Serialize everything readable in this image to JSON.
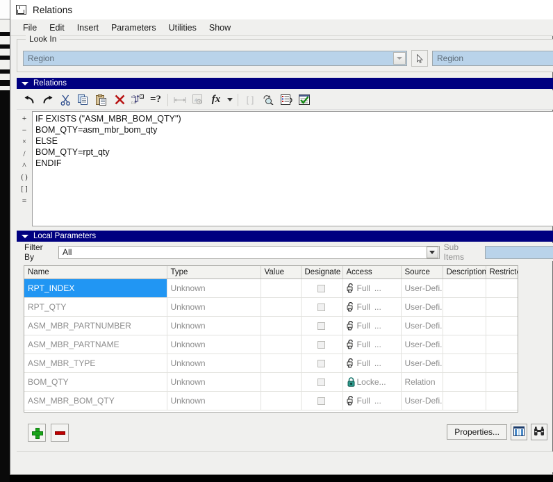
{
  "window": {
    "title": "Relations",
    "icon": "relations-window-icon"
  },
  "menubar": {
    "items": [
      {
        "label": "File"
      },
      {
        "label": "Edit"
      },
      {
        "label": "Insert"
      },
      {
        "label": "Parameters"
      },
      {
        "label": "Utilities"
      },
      {
        "label": "Show"
      }
    ]
  },
  "look_in": {
    "legend": "Look In",
    "combo_value": "Region",
    "pick_icon": "cursor-arrow-icon",
    "region_value": "Region"
  },
  "relations_section": {
    "title": "Relations",
    "collapse_icon": "triangle-down-icon",
    "toolbar": [
      {
        "name": "undo-button",
        "glyph": "↶",
        "disabled": false
      },
      {
        "name": "redo-button",
        "glyph": "↷",
        "disabled": false
      },
      {
        "name": "cut-button",
        "glyph": "✂",
        "disabled": false
      },
      {
        "name": "copy-button",
        "glyph": "❐",
        "disabled": false
      },
      {
        "name": "paste-button",
        "glyph": "ὌB",
        "disabled": false
      },
      {
        "name": "delete-button",
        "glyph": "✕",
        "disabled": false
      },
      {
        "name": "sort-button",
        "glyph": "⇅",
        "disabled": false
      },
      {
        "name": "evaluate-button",
        "glyph": "=?",
        "disabled": false
      },
      {
        "name": "dimension-button",
        "glyph": "↔",
        "disabled": true
      },
      {
        "name": "search-image-button",
        "glyph": "⌽",
        "disabled": true
      },
      {
        "name": "function-button",
        "glyph": "fx",
        "disabled": false
      },
      {
        "name": "function-dropdown",
        "glyph": "▾",
        "disabled": false
      },
      {
        "name": "brackets-button",
        "glyph": "[ ]",
        "disabled": true
      },
      {
        "name": "find-parameter-button",
        "glyph": "⌕",
        "disabled": false
      },
      {
        "name": "list-relations-button",
        "glyph": "≡",
        "disabled": false
      },
      {
        "name": "verify-button",
        "glyph": "✓",
        "disabled": false
      }
    ],
    "operators": [
      "+",
      "−",
      "×",
      "/",
      "^",
      "( )",
      "[ ]",
      "="
    ],
    "code_lines": [
      "IF EXISTS (\"ASM_MBR_BOM_QTY\")",
      "BOM_QTY=asm_mbr_bom_qty",
      "ELSE",
      "BOM_QTY=rpt_qty",
      "ENDIF"
    ]
  },
  "local_parameters": {
    "title": "Local Parameters",
    "collapse_icon": "triangle-down-icon",
    "filter_label": "Filter By",
    "filter_value": "All",
    "sub_items_label": "Sub Items",
    "sub_items_value": "",
    "columns": [
      "Name",
      "Type",
      "Value",
      "Designate",
      "Access",
      "Source",
      "Description",
      "Restricted"
    ],
    "rows": [
      {
        "name": "RPT_INDEX",
        "type": "Unknown",
        "value": "",
        "designate": false,
        "access": "Full",
        "access_icon": "lock-open-icon",
        "access_ellipsis": "...",
        "source": "User-Defi...",
        "description": "",
        "restricted": "",
        "selected": true
      },
      {
        "name": "RPT_QTY",
        "type": "Unknown",
        "value": "",
        "designate": false,
        "access": "Full",
        "access_icon": "lock-open-icon",
        "access_ellipsis": "...",
        "source": "User-Defi...",
        "description": "",
        "restricted": "",
        "selected": false
      },
      {
        "name": "ASM_MBR_PARTNUMBER",
        "type": "Unknown",
        "value": "",
        "designate": false,
        "access": "Full",
        "access_icon": "lock-open-icon",
        "access_ellipsis": "...",
        "source": "User-Defi...",
        "description": "",
        "restricted": "",
        "selected": false
      },
      {
        "name": "ASM_MBR_PARTNAME",
        "type": "Unknown",
        "value": "",
        "designate": false,
        "access": "Full",
        "access_icon": "lock-open-icon",
        "access_ellipsis": "...",
        "source": "User-Defi...",
        "description": "",
        "restricted": "",
        "selected": false
      },
      {
        "name": "ASM_MBR_TYPE",
        "type": "Unknown",
        "value": "",
        "designate": false,
        "access": "Full",
        "access_icon": "lock-open-icon",
        "access_ellipsis": "...",
        "source": "User-Defi...",
        "description": "",
        "restricted": "",
        "selected": false
      },
      {
        "name": "BOM_QTY",
        "type": "Unknown",
        "value": "",
        "designate": false,
        "access": "Locke...",
        "access_icon": "lock-closed-icon",
        "access_ellipsis": "",
        "source": "Relation",
        "description": "",
        "restricted": "",
        "selected": false
      },
      {
        "name": "ASM_MBR_BOM_QTY",
        "type": "Unknown",
        "value": "",
        "designate": false,
        "access": "Full",
        "access_icon": "lock-open-icon",
        "access_ellipsis": "...",
        "source": "User-Defi...",
        "description": "",
        "restricted": "",
        "selected": false
      }
    ],
    "add_button": {
      "name": "add-parameter-button",
      "icon": "plus-icon"
    },
    "remove_button": {
      "name": "remove-parameter-button",
      "icon": "minus-icon"
    },
    "properties_button": "Properties...",
    "columns_button_icon": "columns-icon",
    "find_button_icon": "binoculars-icon"
  },
  "colors": {
    "section_header": "#000080",
    "selection": "#2196f3",
    "field_blue": "#b9d3ea",
    "window_bg": "#f0f0ee",
    "add_green": "#19a319",
    "remove_red": "#c00000",
    "lock_green": "#2e9c8e"
  }
}
